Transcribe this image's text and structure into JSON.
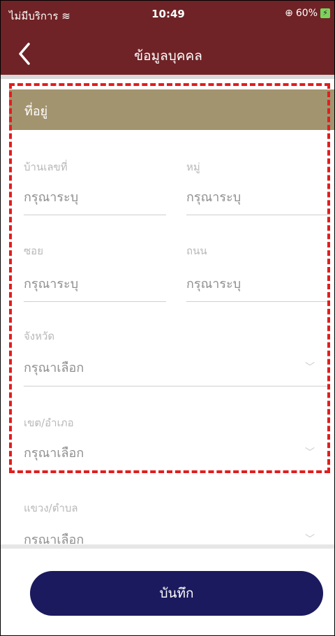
{
  "status_bar": {
    "carrier": "ไม่มีบริการ",
    "time": "10:49",
    "battery_text": "60%",
    "wifi_icon": "wifi-icon"
  },
  "header": {
    "title": "ข้อมูลบุคคล",
    "back_icon": "chevron-left-icon"
  },
  "section": {
    "title": "ที่อยู่"
  },
  "fields": {
    "house_no": {
      "label": "บ้านเลขที่",
      "placeholder": "กรุณาระบุ"
    },
    "moo": {
      "label": "หมู่",
      "placeholder": "กรุณาระบุ"
    },
    "soi": {
      "label": "ซอย",
      "placeholder": "กรุณาระบุ"
    },
    "road": {
      "label": "ถนน",
      "placeholder": "กรุณาระบุ"
    },
    "province": {
      "label": "จังหวัด",
      "placeholder": "กรุณาเลือก"
    },
    "district": {
      "label": "เขต/อำเภอ",
      "placeholder": "กรุณาเลือก"
    },
    "subdistrict": {
      "label": "แขวง/ตำบล",
      "placeholder": "กรุณาเลือก"
    }
  },
  "footer": {
    "save_label": "บันทึก"
  },
  "colors": {
    "header_bg": "#6f2326",
    "section_bg": "#a39470",
    "button_bg": "#1b1a5e",
    "highlight": "#e21d1d"
  }
}
